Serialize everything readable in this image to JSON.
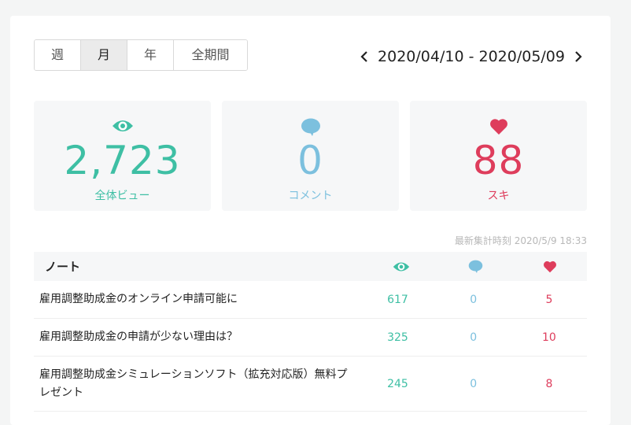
{
  "period_tabs": [
    {
      "label": "週"
    },
    {
      "label": "月"
    },
    {
      "label": "年"
    },
    {
      "label": "全期間"
    }
  ],
  "active_tab": "月",
  "date_range": "2020/04/10 - 2020/05/09",
  "stats": {
    "views": {
      "value": "2,723",
      "label": "全体ビュー",
      "icon": "eye-icon",
      "color": "#3ebfa4"
    },
    "comments": {
      "value": "0",
      "label": "コメント",
      "icon": "speech-bubble-icon",
      "color": "#7cc0de"
    },
    "likes": {
      "value": "88",
      "label": "スキ",
      "icon": "heart-icon",
      "color": "#de3d5c"
    }
  },
  "updated_at": "最新集計時刻 2020/5/9 18:33",
  "table": {
    "header": "ノート",
    "rows": [
      {
        "title": "雇用調整助成金のオンライン申請可能に",
        "views": "617",
        "comments": "0",
        "likes": "5"
      },
      {
        "title": "雇用調整助成金の申請が少ない理由は？",
        "views": "325",
        "comments": "0",
        "likes": "10"
      },
      {
        "title": "雇用調整助成金シミュレーションソフト（拡充対応版）無料プレゼント",
        "views": "245",
        "comments": "0",
        "likes": "8"
      }
    ]
  }
}
